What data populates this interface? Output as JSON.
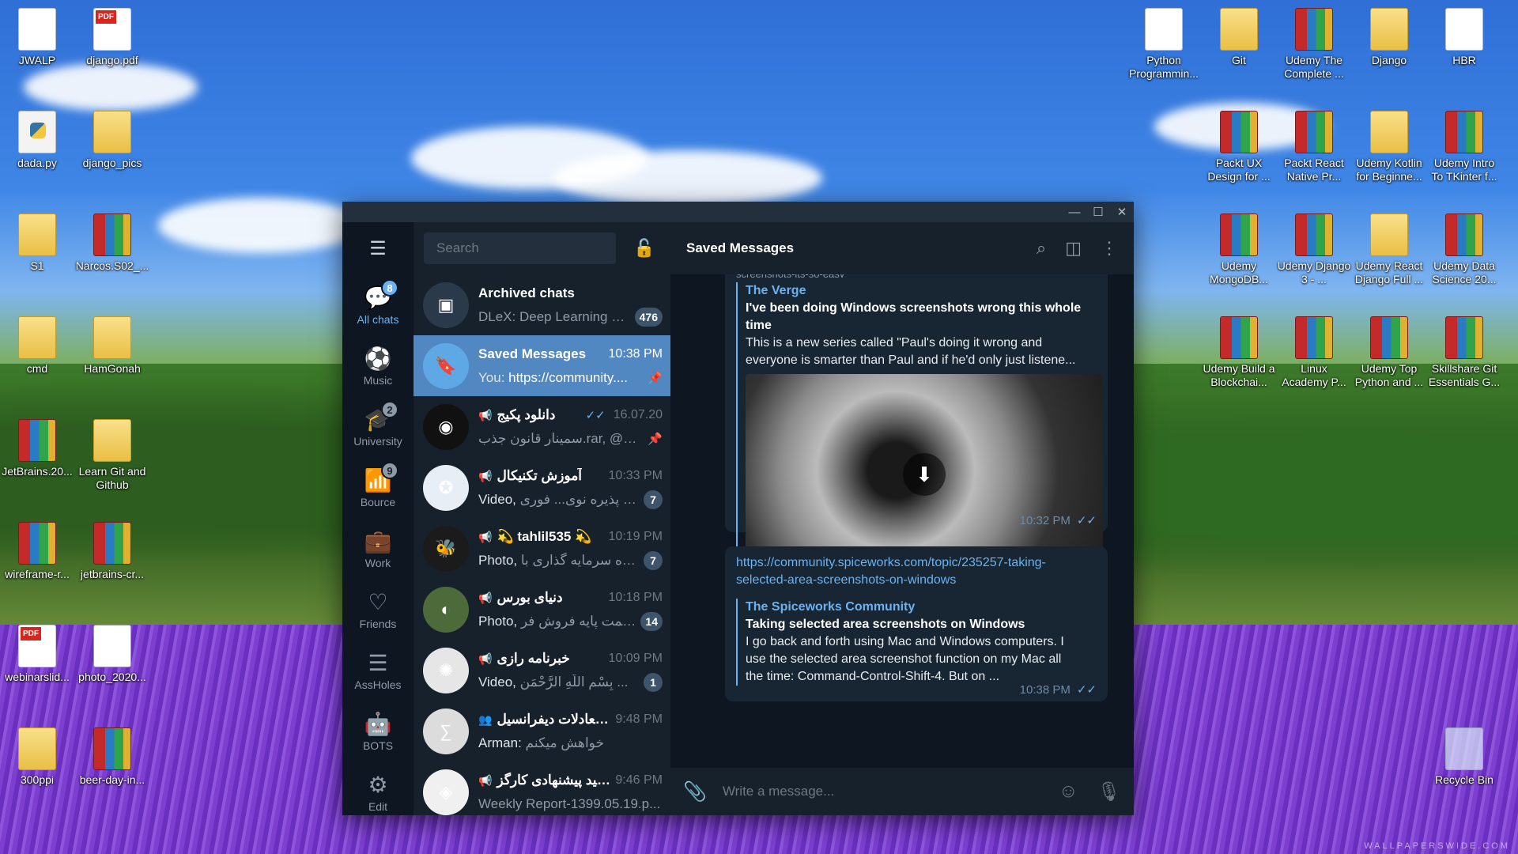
{
  "desktop_icons": [
    {
      "label": "JWALP",
      "type": "g-doc"
    },
    {
      "label": "django.pdf",
      "type": "g-pdf"
    },
    {
      "label": "dada.py",
      "type": "g-py"
    },
    {
      "label": "django_pics",
      "type": "g-folder"
    },
    {
      "label": "S1",
      "type": "g-folder"
    },
    {
      "label": "Narcos.S02_...",
      "type": "g-rar"
    },
    {
      "label": "cmd",
      "type": "g-folder"
    },
    {
      "label": "HamGonah",
      "type": "g-folder"
    },
    {
      "label": "JetBrains.20...",
      "type": "g-rar"
    },
    {
      "label": "Learn Git and Github",
      "type": "g-folder"
    },
    {
      "label": "wireframe-r...",
      "type": "g-rar"
    },
    {
      "label": "jetbrains-cr...",
      "type": "g-rar"
    },
    {
      "label": "webinarslid...",
      "type": "g-pdf"
    },
    {
      "label": "photo_2020...",
      "type": "g-wide"
    },
    {
      "label": "300ppi",
      "type": "g-folder"
    },
    {
      "label": "beer-day-in...",
      "type": "g-rar"
    },
    {
      "label": "Python Programmin...",
      "type": "g-doc"
    },
    {
      "label": "Git",
      "type": "g-folder"
    },
    {
      "label": "Udemy The Complete ...",
      "type": "g-rar"
    },
    {
      "label": "Django",
      "type": "g-folder"
    },
    {
      "label": "HBR",
      "type": "g-doc"
    },
    {
      "label": "Packt UX Design for ...",
      "type": "g-rar"
    },
    {
      "label": "Packt React Native Pr...",
      "type": "g-rar"
    },
    {
      "label": "Udemy Kotlin for Beginne...",
      "type": "g-folder"
    },
    {
      "label": "Udemy Intro To TKinter f...",
      "type": "g-rar"
    },
    {
      "label": "Udemy MongoDB...",
      "type": "g-rar"
    },
    {
      "label": "Udemy Django 3 - ...",
      "type": "g-rar"
    },
    {
      "label": "Udemy React Django Full ...",
      "type": "g-folder"
    },
    {
      "label": "Udemy Data Science 20...",
      "type": "g-rar"
    },
    {
      "label": "Udemy Build a Blockchai...",
      "type": "g-rar"
    },
    {
      "label": "Linux Academy P...",
      "type": "g-rar"
    },
    {
      "label": "Udemy Top Python and ...",
      "type": "g-rar"
    },
    {
      "label": "Skillshare Git Essentials G...",
      "type": "g-rar"
    },
    {
      "label": "Recycle Bin",
      "type": "g-bin"
    }
  ],
  "window": {
    "minimize": "—",
    "maximize": "☐",
    "close": "✕"
  },
  "folders": [
    {
      "label": "All chats",
      "icon": "chat-bubbles-icon",
      "glyph": "💬",
      "badge": "8",
      "active": true
    },
    {
      "label": "Music",
      "icon": "music-icon",
      "glyph": "⚽",
      "badge": ""
    },
    {
      "label": "University",
      "icon": "graduation-cap-icon",
      "glyph": "🎓",
      "badge": "2"
    },
    {
      "label": "Bource",
      "icon": "bar-chart-icon",
      "glyph": "📶",
      "badge": "9"
    },
    {
      "label": "Work",
      "icon": "briefcase-icon",
      "glyph": "💼",
      "badge": ""
    },
    {
      "label": "Friends",
      "icon": "heart-icon",
      "glyph": "♡",
      "badge": ""
    },
    {
      "label": "AssHoles",
      "icon": "list-icon",
      "glyph": "☰",
      "badge": ""
    },
    {
      "label": "BOTS",
      "icon": "robot-icon",
      "glyph": "🤖",
      "badge": ""
    },
    {
      "label": "Edit",
      "icon": "sliders-icon",
      "glyph": "⚙",
      "badge": ""
    }
  ],
  "search": {
    "placeholder": "Search"
  },
  "chats": [
    {
      "name": "Archived chats",
      "preview": "DLeX: Deep Learning E...",
      "time": "",
      "count": "476",
      "avatar_color": "#2b3a4a",
      "avatar_glyph": "▣",
      "channel": false
    },
    {
      "name": "Saved Messages",
      "preview_who": "You: ",
      "preview": "https://community....",
      "time": "10:38 PM",
      "count": "",
      "pinned": true,
      "avatar_color": "#5ea8e6",
      "avatar_glyph": "🔖",
      "selected": true
    },
    {
      "name": "دانلود پکیج",
      "preview": "سمینار قانون جذب.rar, @vi...",
      "time": "16.07.20",
      "count": "",
      "pinned": true,
      "ticks": true,
      "avatar_color": "#111",
      "avatar_glyph": "◉",
      "channel": true
    },
    {
      "name": "آموزش تکنیکال",
      "preview_who": "Video, ",
      "preview": "آغاز پذیره نوی... فوری",
      "time": "10:33 PM",
      "count": "7",
      "avatar_color": "#e8eef5",
      "avatar_glyph": "✪",
      "channel": true
    },
    {
      "name": "💫 tahlil535 💫",
      "preview_who": "Photo, ",
      "preview": "گروه سرمایه گذاری با...",
      "time": "10:19 PM",
      "count": "7",
      "avatar_color": "#1b1b1b",
      "avatar_glyph": "🐝",
      "channel": true
    },
    {
      "name": "دنیای بورس",
      "preview_who": "Photo, ",
      "preview": "قیمت پایه فروش فر...",
      "time": "10:18 PM",
      "count": "14",
      "avatar_color": "#4d6b3a",
      "avatar_glyph": "◐",
      "channel": true
    },
    {
      "name": "خبرنامه رازی",
      "preview_who": "Video, ",
      "preview": "بِسْمِ اللَّهِ الرَّحْمَنِ ...",
      "time": "10:09 PM",
      "count": "1",
      "avatar_color": "#e6e6e6",
      "avatar_glyph": "✺",
      "channel": true
    },
    {
      "name": "معادلات دیفرانسیل...",
      "preview_who": "Arman: ",
      "preview": "خواهش میکنم",
      "time": "9:48 PM",
      "count": "",
      "avatar_color": "#dcdcdc",
      "avatar_glyph": "∑",
      "group": true
    },
    {
      "name": "سید پیشنهادی کارگز...",
      "preview": "Weekly Report-1399.05.19.p...",
      "time": "9:46 PM",
      "count": "",
      "avatar_color": "#f0f0f0",
      "avatar_glyph": "◈",
      "channel": true
    }
  ],
  "main": {
    "title": "Saved Messages",
    "message1": {
      "partial_text": "screenshots-its-so-easy",
      "site": "The Verge",
      "title": "I've been doing Windows screenshots wrong this whole time",
      "desc": "This is a new series called \"Paul's doing it wrong and everyone is smarter than Paul and if he'd only just listene...",
      "time": "10:32 PM"
    },
    "message2": {
      "link": "https://community.spiceworks.com/topic/235257-taking-selected-area-screenshots-on-windows",
      "site": "The Spiceworks Community",
      "title": "Taking selected area screenshots on Windows",
      "desc": "I go back and forth using Mac and Windows computers. I use the selected area screenshot function on my Mac all the time: Command-Control-Shift-4. But on ...",
      "time": "10:38 PM"
    },
    "composer_placeholder": "Write a message..."
  },
  "watermark": "WALLPAPERSWIDE.COM"
}
